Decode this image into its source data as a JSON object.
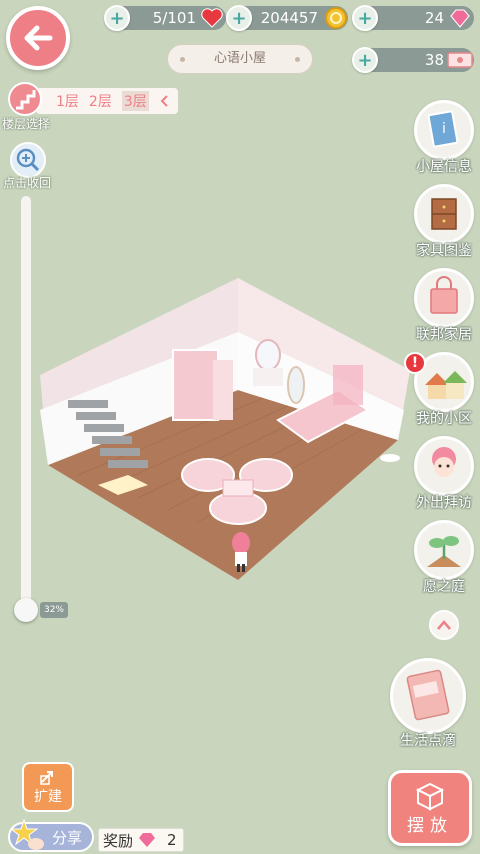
{
  "resources": {
    "energy": "5/101",
    "coins": "204457",
    "diamonds": "24",
    "tickets": "38"
  },
  "house": {
    "name": "心语小屋"
  },
  "floors": {
    "items": [
      "1层",
      "2层",
      "3层"
    ],
    "active_index": 2,
    "select_label": "楼层选择"
  },
  "zoom": {
    "label": "点击收回",
    "value": "32%"
  },
  "menu": {
    "items": [
      "小屋信息",
      "家具图鉴",
      "联邦家居",
      "我的小区",
      "外出拜访",
      "愿之庭"
    ],
    "life_label": "生活点滴"
  },
  "bottom": {
    "expand_label": "扩建",
    "share_label": "分享",
    "reward_label": "奖励",
    "reward_count": "2",
    "place_label": "摆放"
  },
  "colors": {
    "background": "#c9d6bd",
    "accent_pink": "#ef7f86",
    "pill_gray": "#8b9a95",
    "expand_orange": "#f29a55"
  }
}
